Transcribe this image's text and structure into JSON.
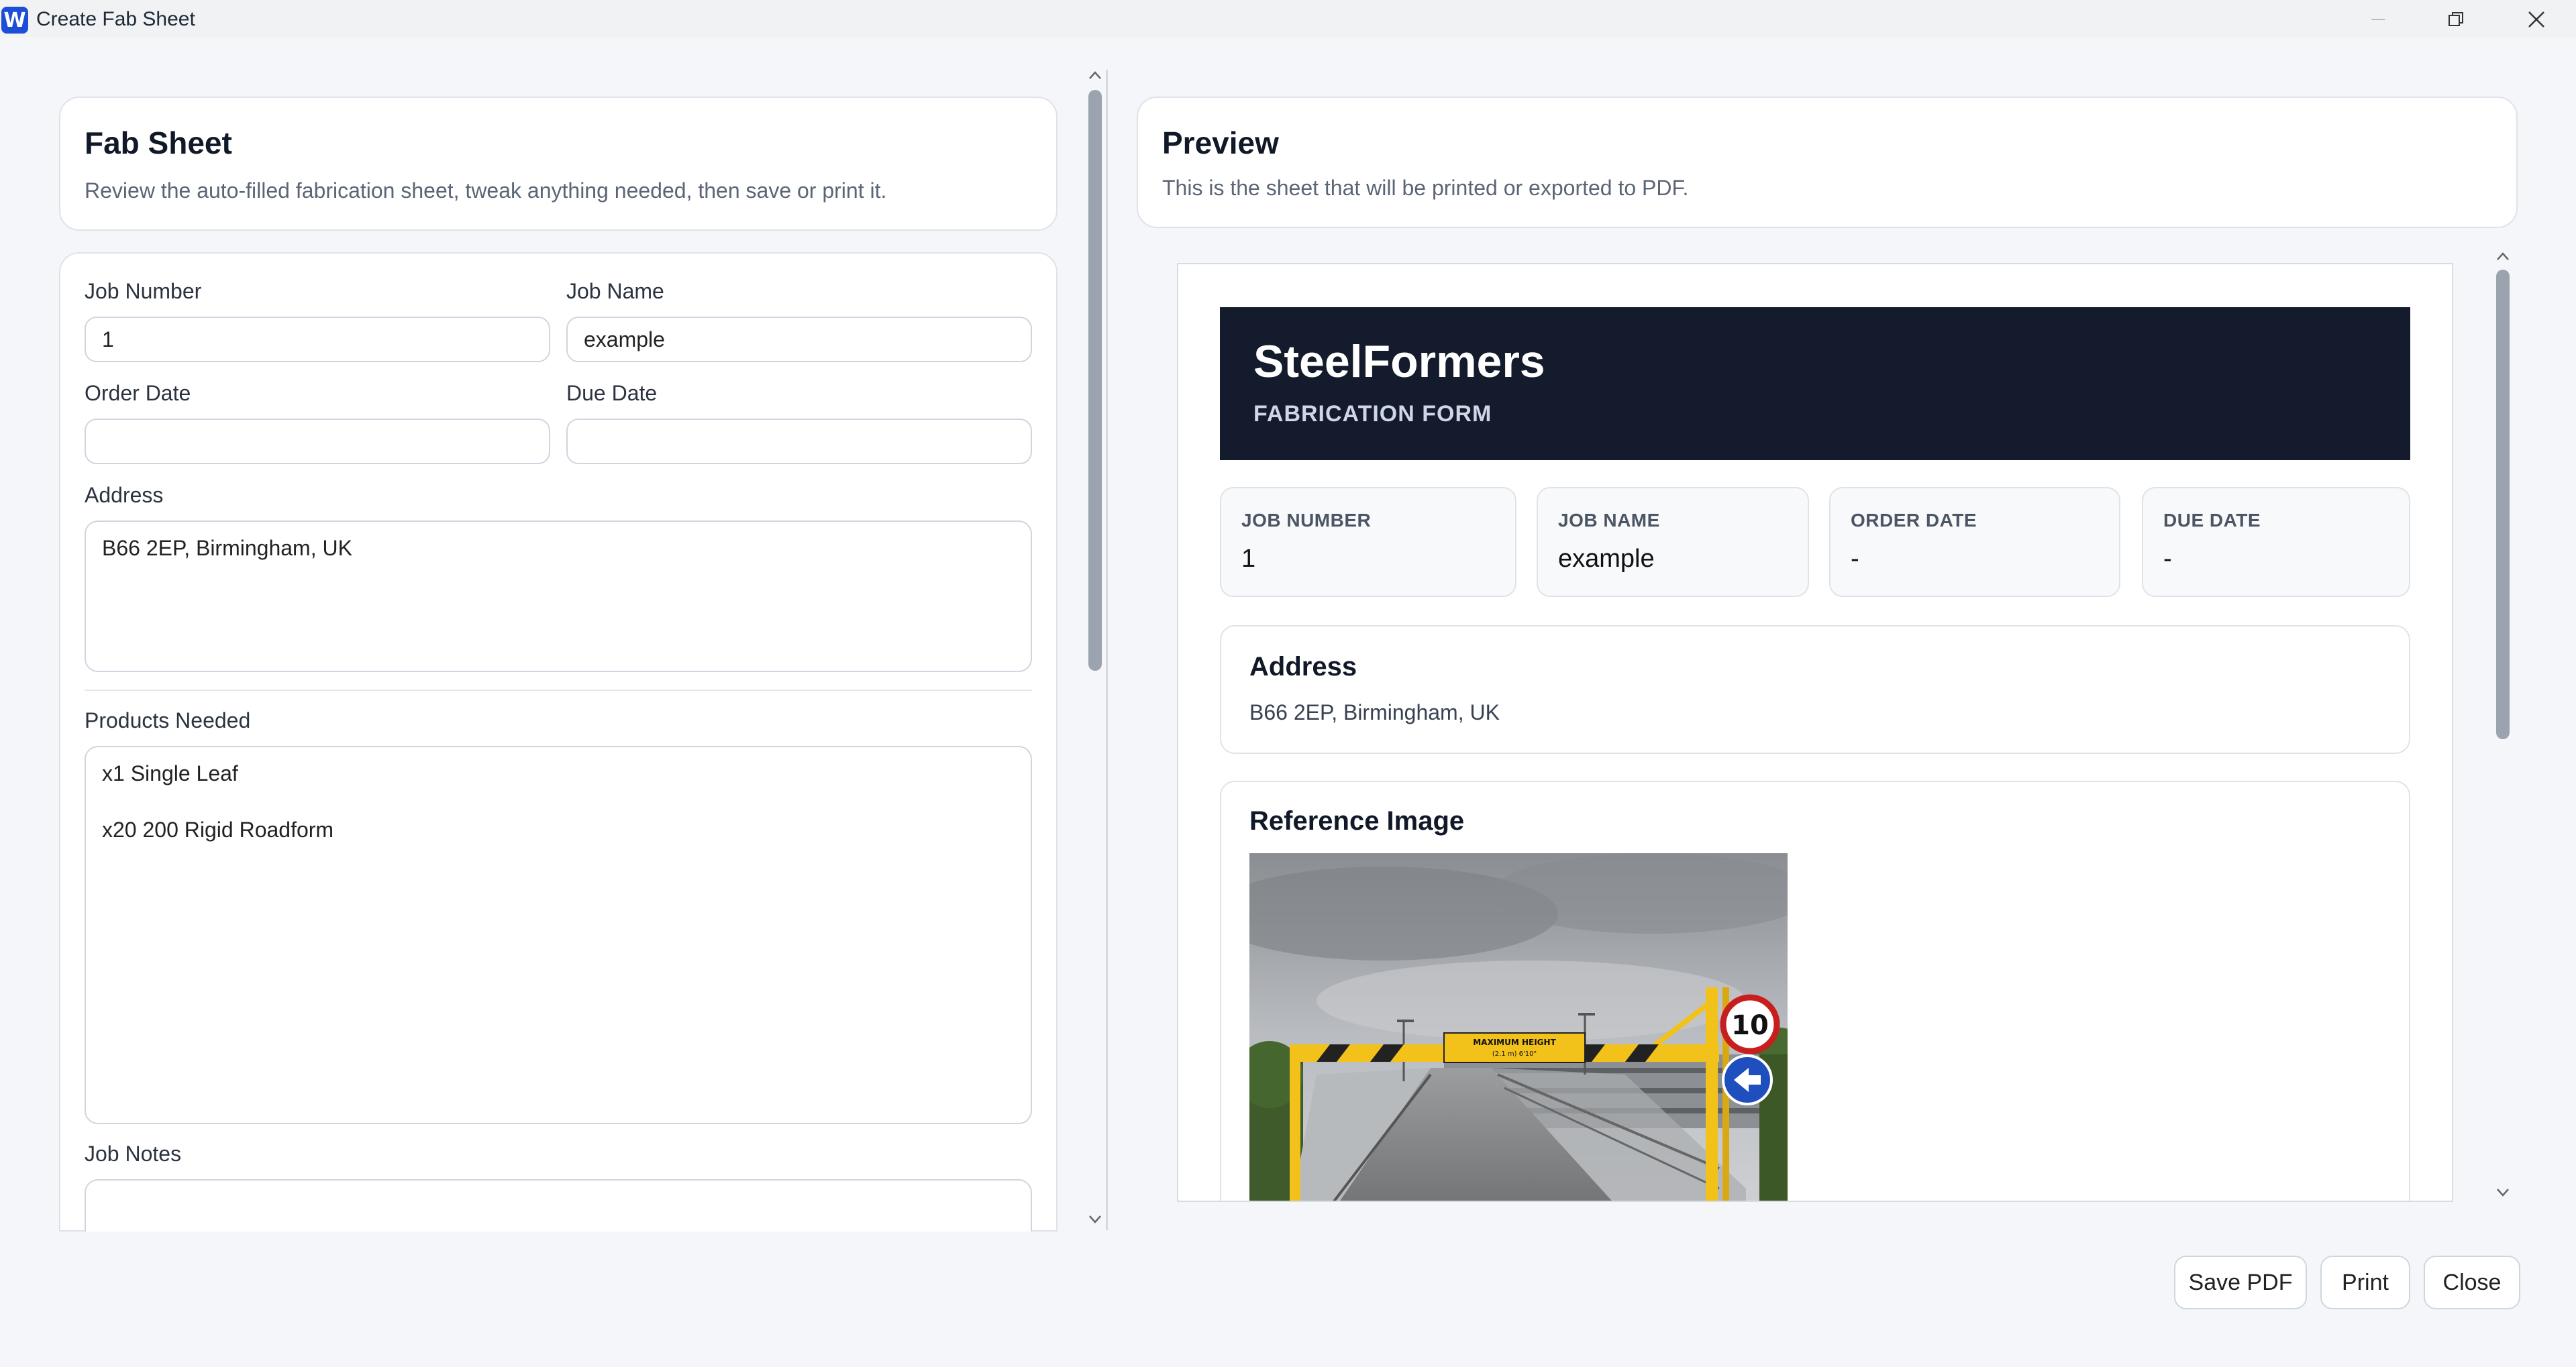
{
  "window": {
    "title": "Create Fab Sheet",
    "app_icon": "W"
  },
  "form_header": {
    "title": "Fab Sheet",
    "subtitle": "Review the auto-filled fabrication sheet, tweak anything needed, then save or print it."
  },
  "form": {
    "job_number": {
      "label": "Job Number",
      "value": "1"
    },
    "job_name": {
      "label": "Job Name",
      "value": "example"
    },
    "order_date": {
      "label": "Order Date",
      "value": ""
    },
    "due_date": {
      "label": "Due Date",
      "value": ""
    },
    "address": {
      "label": "Address",
      "value": "B66 2EP, Birmingham, UK"
    },
    "products": {
      "label": "Products Needed",
      "value": "x1 Single Leaf\n\nx20 200 Rigid Roadform"
    },
    "job_notes": {
      "label": "Job Notes",
      "value": ""
    }
  },
  "preview_header": {
    "title": "Preview",
    "subtitle": "This is the sheet that will be printed or exported to PDF."
  },
  "sheet": {
    "brand": "SteelFormers",
    "form_title": "FABRICATION FORM",
    "info": [
      {
        "label": "JOB NUMBER",
        "value": "1"
      },
      {
        "label": "JOB NAME",
        "value": "example"
      },
      {
        "label": "ORDER DATE",
        "value": "-"
      },
      {
        "label": "DUE DATE",
        "value": "-"
      }
    ],
    "address_title": "Address",
    "address_value": "B66 2EP, Birmingham, UK",
    "reference_title": "Reference Image",
    "reference_image": {
      "sign_text": "MAXIMUM HEIGHT",
      "sign_sub": "(2.1 m) 6'10\"",
      "speed_limit": "10"
    }
  },
  "buttons": {
    "save_pdf": "Save PDF",
    "print": "Print",
    "close": "Close"
  },
  "colors": {
    "banner": "#131b2c",
    "accent": "#1d4ed8",
    "barrier_yellow": "#f2c21b"
  }
}
